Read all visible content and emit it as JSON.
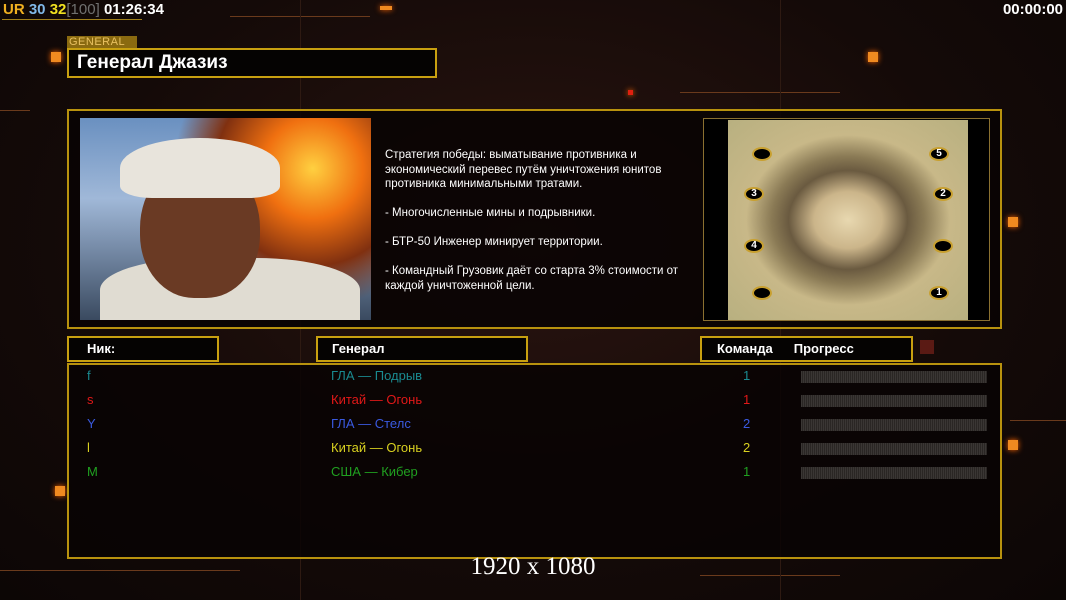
{
  "hud": {
    "ur": "UR",
    "fps": "30",
    "val": "32",
    "limit": "[100]",
    "time": "01:26:34"
  },
  "clock": "00:00:00",
  "general_tag": "GENERAL",
  "general_name": "Генерал Джазиз",
  "description": [
    "Стратегия победы: выматывание противника и экономический перевес путём уничтожения юнитов противника минимальными тратами.",
    "- Многочисленные мины и подрывники.",
    "- БТР-50 Инженер минирует территории.",
    "- Командный Грузовик даёт со старта 3% стоимости от каждой уничтоженной цели."
  ],
  "map": {
    "spawns": [
      "1",
      "2",
      "3",
      "4",
      "5"
    ]
  },
  "headers": {
    "nick": "Ник:",
    "general": "Генерал",
    "team": "Команда",
    "progress": "Прогресс"
  },
  "players": [
    {
      "nick": "f",
      "general": "ГЛА — Подрыв",
      "team": "1",
      "color": "#1a8a90",
      "progress": 0
    },
    {
      "nick": "s",
      "general": "Китай — Огонь",
      "team": "1",
      "color": "#e01818",
      "progress": 0
    },
    {
      "nick": "Y",
      "general": "ГЛА — Стелс",
      "team": "2",
      "color": "#3a5ae0",
      "progress": 0
    },
    {
      "nick": "l",
      "general": "Китай — Огонь",
      "team": "2",
      "color": "#d8d020",
      "progress": 0
    },
    {
      "nick": "M",
      "general": "США — Кибер",
      "team": "1",
      "color": "#20a020",
      "progress": 0
    }
  ],
  "resolution": "1920 x 1080"
}
